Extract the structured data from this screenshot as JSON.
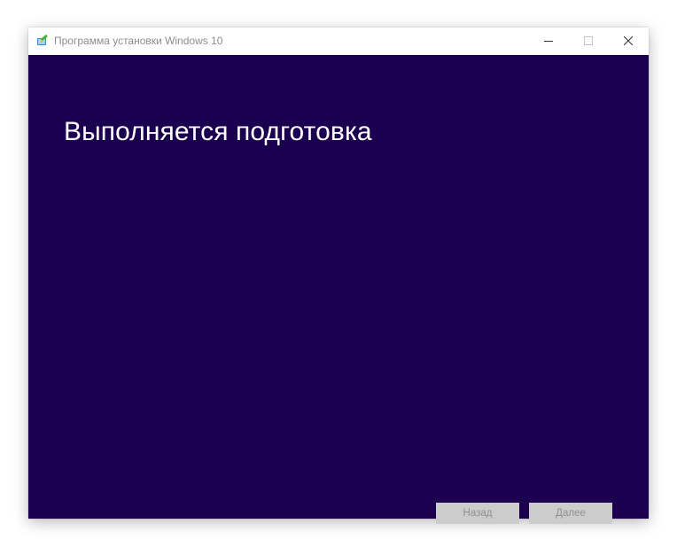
{
  "window": {
    "title": "Программа установки Windows 10",
    "background_color": "#1b0050",
    "icon": "windows-setup-icon"
  },
  "controls": {
    "minimize_icon": "minimize-icon",
    "maximize_icon": "maximize-icon",
    "close_icon": "close-icon"
  },
  "main": {
    "heading": "Выполняется подготовка"
  },
  "footer": {
    "back_label": "Назад",
    "next_label": "Далее",
    "buttons_disabled": true
  }
}
